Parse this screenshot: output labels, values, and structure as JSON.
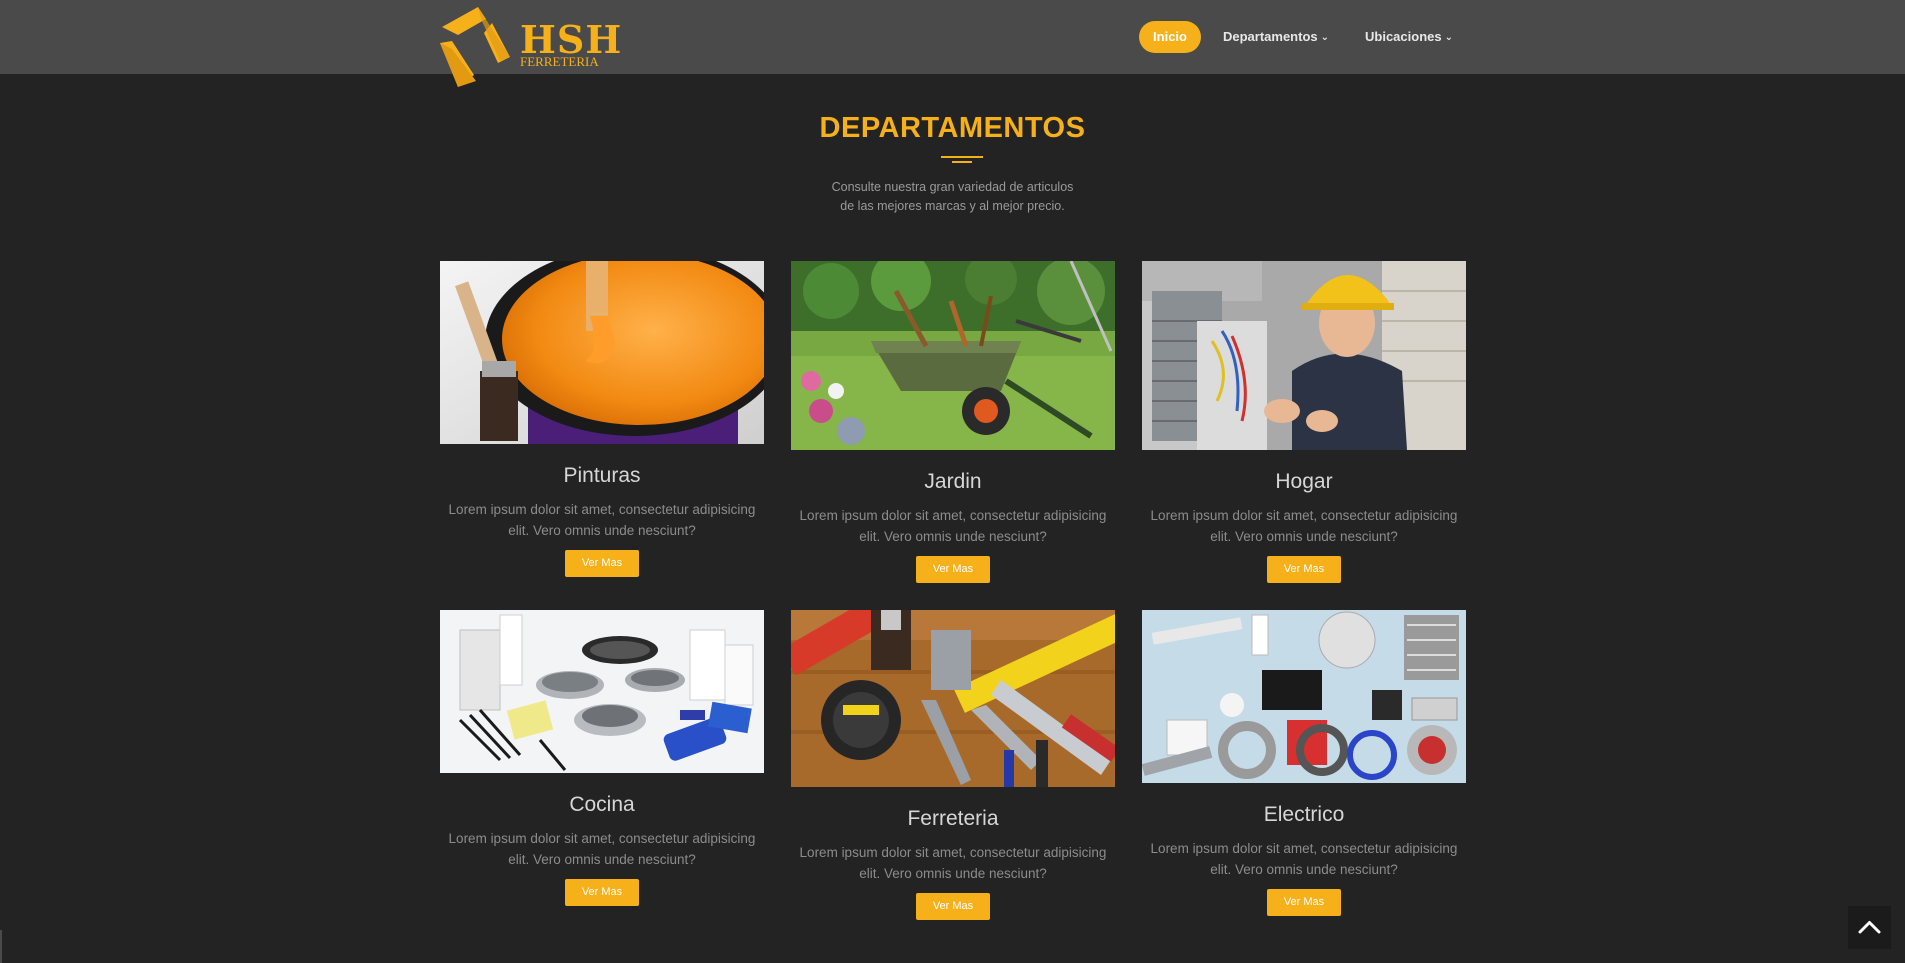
{
  "brand": {
    "name": "HSH",
    "sub": "FERRETERIA",
    "accent": "#f5b01a"
  },
  "nav": {
    "items": [
      {
        "label": "Inicio",
        "active": true
      },
      {
        "label": "Departamentos",
        "dropdown": true
      },
      {
        "label": "Ubicaciones",
        "dropdown": true
      }
    ]
  },
  "section": {
    "title": "DEPARTAMENTOS",
    "subtitle_line1": "Consulte nuestra gran variedad de articulos",
    "subtitle_line2": "de las mejores marcas y al mejor precio."
  },
  "cards": [
    {
      "title": "Pinturas",
      "text": "Lorem ipsum dolor sit amet, consectetur adipisicing elit. Vero omnis unde nesciunt?",
      "button": "Ver Mas",
      "image": "paint-bucket-image"
    },
    {
      "title": "Jardin",
      "text": "Lorem ipsum dolor sit amet, consectetur adipisicing elit. Vero omnis unde nesciunt?",
      "button": "Ver Mas",
      "image": "garden-wheelbarrow-image"
    },
    {
      "title": "Hogar",
      "text": "Lorem ipsum dolor sit amet, consectetur adipisicing elit. Vero omnis unde nesciunt?",
      "button": "Ver Mas",
      "image": "technician-repair-image"
    },
    {
      "title": "Cocina",
      "text": "Lorem ipsum dolor sit amet, consectetur adipisicing elit. Vero omnis unde nesciunt?",
      "button": "Ver Mas",
      "image": "cookware-image"
    },
    {
      "title": "Ferreteria",
      "text": "Lorem ipsum dolor sit amet, consectetur adipisicing elit. Vero omnis unde nesciunt?",
      "button": "Ver Mas",
      "image": "tools-image"
    },
    {
      "title": "Electrico",
      "text": "Lorem ipsum dolor sit amet, consectetur adipisicing elit. Vero omnis unde nesciunt?",
      "button": "Ver Mas",
      "image": "electrical-supplies-image"
    }
  ],
  "scroll_top": {
    "icon": "chevron-up-icon"
  }
}
